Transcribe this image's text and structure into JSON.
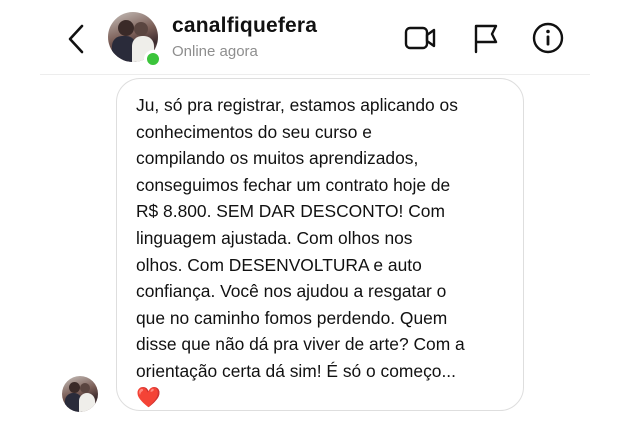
{
  "header": {
    "username": "canalfiquefera",
    "status": "Online agora",
    "icons": {
      "back": "chevron-left-icon",
      "video": "video-camera-icon",
      "flag": "flag-icon",
      "info": "info-icon"
    },
    "online_color": "#3bc43b"
  },
  "message": {
    "lines": [
      "Ju, só pra registrar, estamos aplicando os",
      "conhecimentos do seu curso e",
      "compilando os muitos aprendizados,",
      "conseguimos fechar um contrato hoje de",
      "R$ 8.800. SEM DAR DESCONTO! Com",
      "linguagem ajustada. Com olhos nos",
      "olhos. Com DESENVOLTURA e auto",
      "confiança. Você nos ajudou a resgatar o",
      "que no caminho fomos perdendo. Quem",
      "disse que não dá pra viver de arte? Com a",
      "orientação certa dá sim! É só o começo..."
    ],
    "emoji": "❤️"
  }
}
